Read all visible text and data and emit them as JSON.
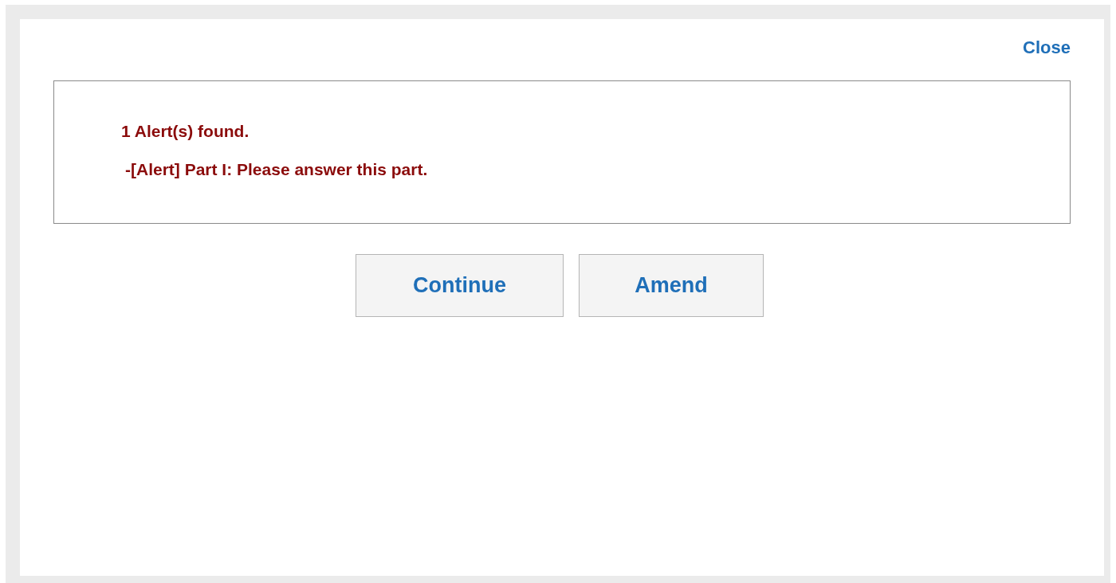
{
  "close_link": "Close",
  "alert": {
    "summary": "1 Alert(s) found.",
    "items": [
      "-[Alert] Part I: Please answer this part."
    ]
  },
  "buttons": [
    "Continue",
    "Amend"
  ]
}
